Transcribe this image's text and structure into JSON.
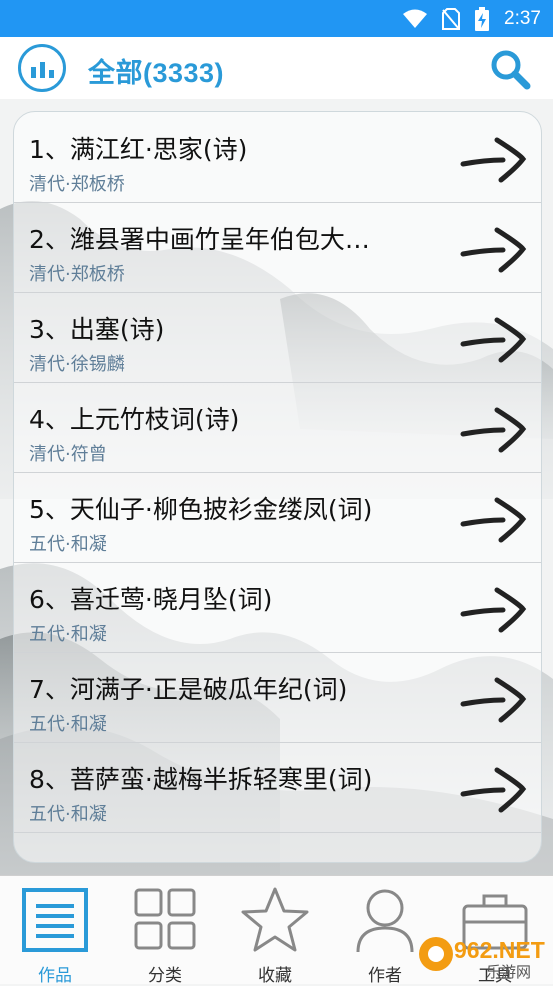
{
  "status_bar": {
    "time": "2:37"
  },
  "header": {
    "title": "全部(3333)"
  },
  "poems": [
    {
      "title": "1、满江红·思家(诗)",
      "author": "清代·郑板桥"
    },
    {
      "title": "2、潍县署中画竹呈年伯包大…",
      "author": "清代·郑板桥"
    },
    {
      "title": "3、出塞(诗)",
      "author": "清代·徐锡麟"
    },
    {
      "title": "4、上元竹枝词(诗)",
      "author": "清代·符曾"
    },
    {
      "title": "5、天仙子·柳色披衫金缕凤(词)",
      "author": "五代·和凝"
    },
    {
      "title": "6、喜迁莺·晓月坠(词)",
      "author": "五代·和凝"
    },
    {
      "title": "7、河满子·正是破瓜年纪(词)",
      "author": "五代·和凝"
    },
    {
      "title": "8、菩萨蛮·越梅半拆轻寒里(词)",
      "author": "五代·和凝"
    }
  ],
  "nav": [
    {
      "label": "作品",
      "icon": "list-icon",
      "active": true
    },
    {
      "label": "分类",
      "icon": "grid-icon",
      "active": false
    },
    {
      "label": "收藏",
      "icon": "star-icon",
      "active": false
    },
    {
      "label": "作者",
      "icon": "person-icon",
      "active": false
    },
    {
      "label": "工具",
      "icon": "toolbox-icon",
      "active": false
    }
  ],
  "watermark": {
    "brand": "962.NET",
    "sub": "乐游网"
  },
  "colors": {
    "status_bar": "#2196f3",
    "accent": "#2a9ad8",
    "author_text": "#5f7e98"
  }
}
